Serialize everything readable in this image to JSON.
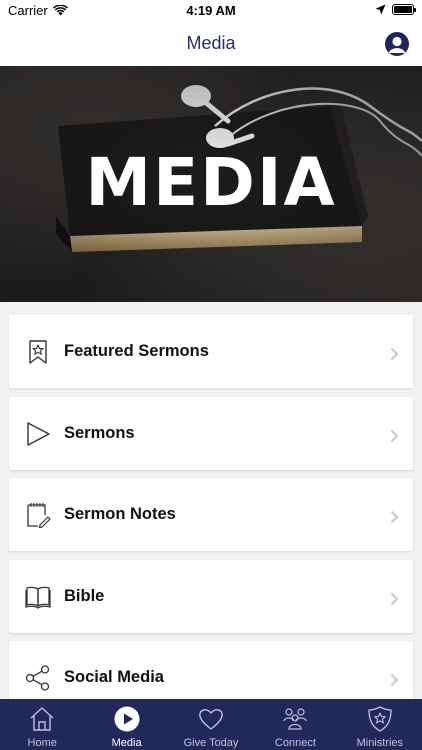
{
  "status_bar": {
    "carrier": "Carrier",
    "time": "4:19 AM"
  },
  "nav": {
    "title": "Media"
  },
  "hero": {
    "title": "MEDIA"
  },
  "menu": [
    {
      "label": "Featured Sermons",
      "icon": "bookmark-star-icon"
    },
    {
      "label": "Sermons",
      "icon": "play-triangle-icon"
    },
    {
      "label": "Sermon Notes",
      "icon": "notepad-pencil-icon"
    },
    {
      "label": "Bible",
      "icon": "open-book-icon"
    },
    {
      "label": "Social Media",
      "icon": "share-icon"
    }
  ],
  "tabs": [
    {
      "label": "Home",
      "icon": "home-icon",
      "active": false
    },
    {
      "label": "Media",
      "icon": "play-circle-icon",
      "active": true
    },
    {
      "label": "Give Today",
      "icon": "heart-icon",
      "active": false
    },
    {
      "label": "Connect",
      "icon": "people-icon",
      "active": false
    },
    {
      "label": "Ministries",
      "icon": "shield-star-icon",
      "active": false
    }
  ],
  "colors": {
    "nav_title": "#2a2d6b",
    "tab_bar": "#22275c",
    "background": "#f1f1f3"
  }
}
